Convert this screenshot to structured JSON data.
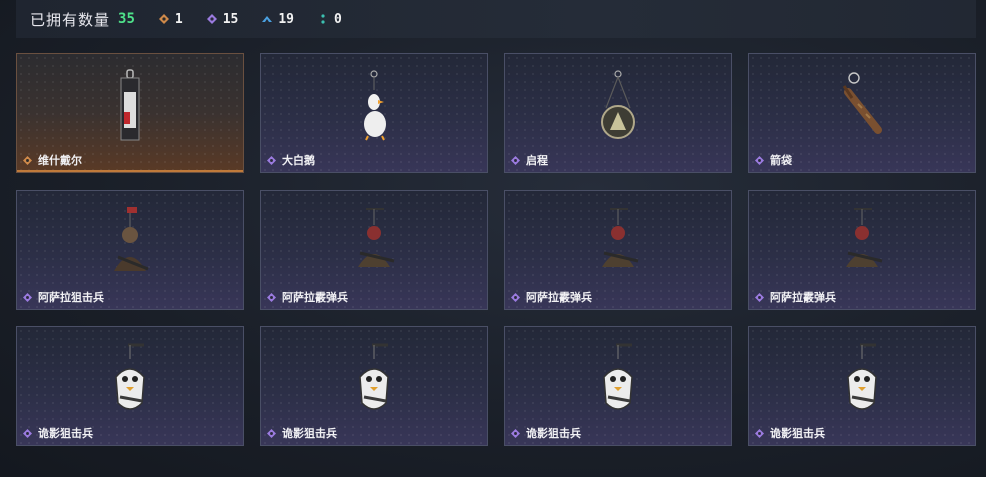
{
  "header": {
    "owned_label": "已拥有数量",
    "owned_count": "35",
    "stats": [
      {
        "icon": "orange-diamond-icon",
        "color": "#d08a4a",
        "value": "1"
      },
      {
        "icon": "purple-diamond-icon",
        "color": "#9b7be0",
        "value": "15"
      },
      {
        "icon": "blue-chevron-icon",
        "color": "#4aa0e0",
        "value": "19"
      },
      {
        "icon": "teal-dots-icon",
        "color": "#3cc0b0",
        "value": "0"
      }
    ]
  },
  "items": [
    {
      "name": "维什戴尔",
      "rarity": "orange",
      "icon": "tag-keychain-icon"
    },
    {
      "name": "大白鹅",
      "rarity": "purple",
      "icon": "goose-keychain-icon"
    },
    {
      "name": "启程",
      "rarity": "purple",
      "icon": "medal-keychain-icon"
    },
    {
      "name": "箭袋",
      "rarity": "purple",
      "icon": "quiver-keychain-icon"
    },
    {
      "name": "阿萨拉狙击兵",
      "rarity": "purple",
      "icon": "soldier-keychain-icon"
    },
    {
      "name": "阿萨拉霰弹兵",
      "rarity": "purple",
      "icon": "soldier-keychain-icon"
    },
    {
      "name": "阿萨拉霰弹兵",
      "rarity": "purple",
      "icon": "soldier-keychain-icon"
    },
    {
      "name": "阿萨拉霰弹兵",
      "rarity": "purple",
      "icon": "soldier-keychain-icon"
    },
    {
      "name": "诡影狙击兵",
      "rarity": "purple",
      "icon": "phantom-keychain-icon"
    },
    {
      "name": "诡影狙击兵",
      "rarity": "purple",
      "icon": "phantom-keychain-icon"
    },
    {
      "name": "诡影狙击兵",
      "rarity": "purple",
      "icon": "phantom-keychain-icon"
    },
    {
      "name": "诡影狙击兵",
      "rarity": "purple",
      "icon": "phantom-keychain-icon"
    }
  ],
  "colors": {
    "rarity_orange": "#d08a4a",
    "rarity_purple": "#9b7be0",
    "count_green": "#4ee08a"
  }
}
